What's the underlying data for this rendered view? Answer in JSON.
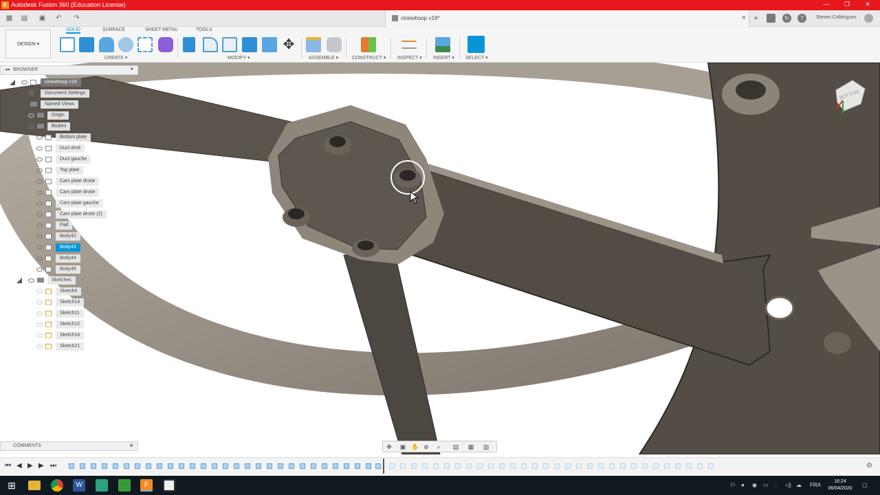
{
  "window": {
    "title": "Autodesk Fusion 360 (Education License)"
  },
  "document": {
    "tab_title": "cinewhoop v19*"
  },
  "user": {
    "name": "Steven Collongues"
  },
  "workspace": {
    "label": "DESIGN ▾"
  },
  "ribbon_tabs": [
    "SOLID",
    "SURFACE",
    "SHEET METAL",
    "TOOLS"
  ],
  "ribbon_groups": [
    "CREATE ▾",
    "MODIFY ▾",
    "ASSEMBLE ▾",
    "CONSTRUCT ▾",
    "INSPECT ▾",
    "INSERT ▾",
    "SELECT ▾"
  ],
  "browser": {
    "header": "BROWSER",
    "root": "cinewhoop v19",
    "items": [
      {
        "label": "Document Settings",
        "icon": "gear-icon"
      },
      {
        "label": "Named Views",
        "icon": "folder-icon"
      },
      {
        "label": "Origin",
        "icon": "folder-icon"
      },
      {
        "label": "Bodies",
        "icon": "folder-icon"
      }
    ],
    "bodies": [
      "Bottom plate",
      "Duct droit",
      "Duct gauche",
      "Top plate",
      "Cam plate droite",
      "Cam plate droite",
      "Cam plate gauche",
      "Cam plate droite (2)",
      "Pad",
      "Body42",
      "Body43",
      "Body44",
      "Body45"
    ],
    "selected_body": "Body43",
    "sketches_folder": "Sketches",
    "sketches": [
      "Sketch4",
      "Sketch14",
      "Sketch11",
      "Sketch12",
      "Sketch16",
      "Sketch21"
    ]
  },
  "comments": {
    "label": "COMMENTS"
  },
  "viewcube": {
    "face_label": "BOTTOM"
  },
  "taskbar": {
    "time": "16:24",
    "date": "06/04/2020",
    "lang": "FRA"
  },
  "colors": {
    "title_bar": "#e6171d",
    "accent": "#0696d7",
    "body_fill": "#575048",
    "body_edge": "#8e857b",
    "taskbar": "#101820"
  }
}
